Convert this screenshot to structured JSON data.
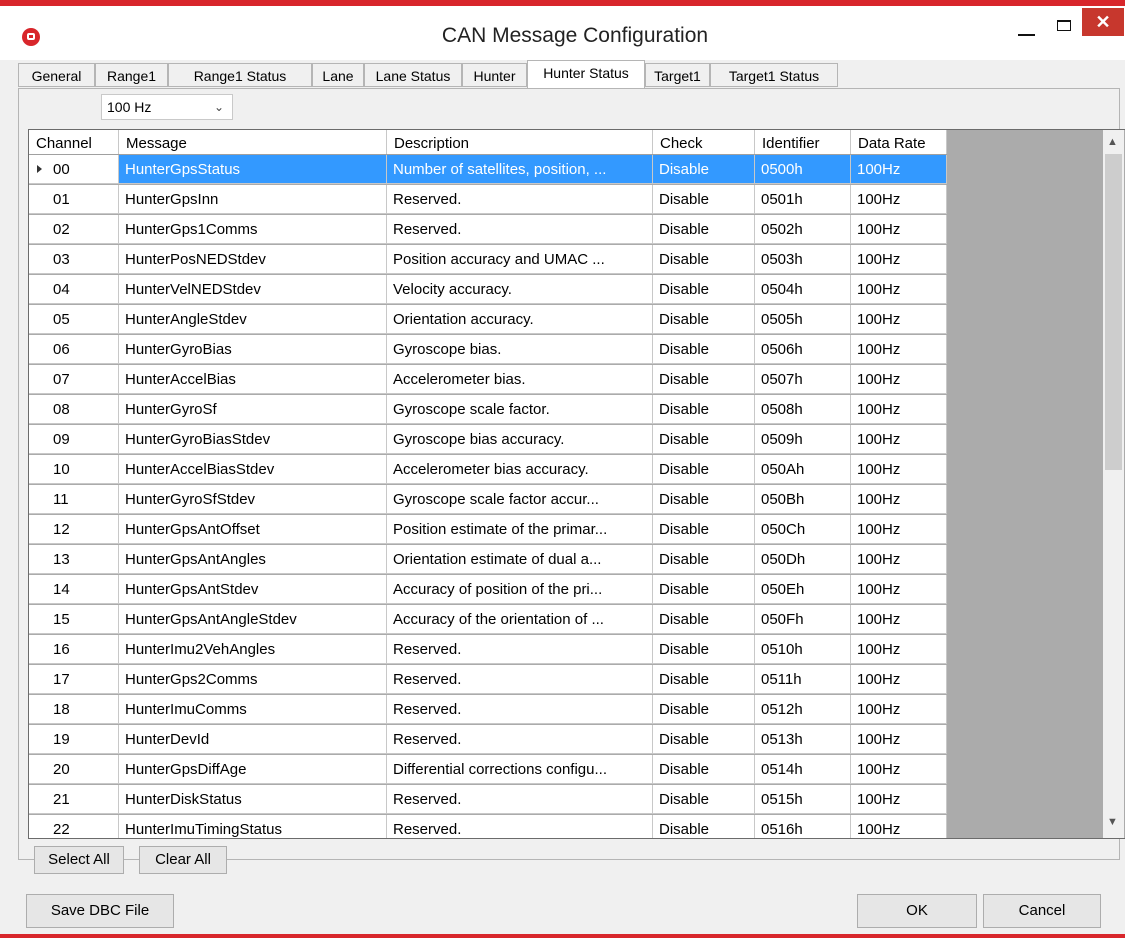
{
  "window": {
    "title": "CAN Message Configuration",
    "close_glyph": "✕",
    "accent": "#d8262b"
  },
  "tabs": [
    {
      "label": "General"
    },
    {
      "label": "Range1"
    },
    {
      "label": "Range1 Status"
    },
    {
      "label": "Lane"
    },
    {
      "label": "Lane Status"
    },
    {
      "label": "Hunter"
    },
    {
      "label": "Hunter Status",
      "active": true
    },
    {
      "label": "Target1"
    },
    {
      "label": "Target1 Status"
    }
  ],
  "rate_select": {
    "value": "100 Hz",
    "icon": "chevron-down-icon"
  },
  "grid": {
    "columns": [
      "Channel",
      "Message",
      "Description",
      "Check",
      "Identifier",
      "Data Rate"
    ],
    "selected_row": 0,
    "rows": [
      {
        "channel": "00",
        "message": "HunterGpsStatus",
        "description": "Number of satellites, position, ...",
        "check": "Disable",
        "identifier": "0500h",
        "rate": "100Hz"
      },
      {
        "channel": "01",
        "message": "HunterGpsInn",
        "description": "Reserved.",
        "check": "Disable",
        "identifier": "0501h",
        "rate": "100Hz"
      },
      {
        "channel": "02",
        "message": "HunterGps1Comms",
        "description": "Reserved.",
        "check": "Disable",
        "identifier": "0502h",
        "rate": "100Hz"
      },
      {
        "channel": "03",
        "message": "HunterPosNEDStdev",
        "description": "Position accuracy and UMAC ...",
        "check": "Disable",
        "identifier": "0503h",
        "rate": "100Hz"
      },
      {
        "channel": "04",
        "message": "HunterVelNEDStdev",
        "description": "Velocity accuracy.",
        "check": "Disable",
        "identifier": "0504h",
        "rate": "100Hz"
      },
      {
        "channel": "05",
        "message": "HunterAngleStdev",
        "description": "Orientation accuracy.",
        "check": "Disable",
        "identifier": "0505h",
        "rate": "100Hz"
      },
      {
        "channel": "06",
        "message": "HunterGyroBias",
        "description": "Gyroscope bias.",
        "check": "Disable",
        "identifier": "0506h",
        "rate": "100Hz"
      },
      {
        "channel": "07",
        "message": "HunterAccelBias",
        "description": "Accelerometer bias.",
        "check": "Disable",
        "identifier": "0507h",
        "rate": "100Hz"
      },
      {
        "channel": "08",
        "message": "HunterGyroSf",
        "description": "Gyroscope scale factor.",
        "check": "Disable",
        "identifier": "0508h",
        "rate": "100Hz"
      },
      {
        "channel": "09",
        "message": "HunterGyroBiasStdev",
        "description": "Gyroscope bias accuracy.",
        "check": "Disable",
        "identifier": "0509h",
        "rate": "100Hz"
      },
      {
        "channel": "10",
        "message": "HunterAccelBiasStdev",
        "description": "Accelerometer bias accuracy.",
        "check": "Disable",
        "identifier": "050Ah",
        "rate": "100Hz"
      },
      {
        "channel": "11",
        "message": "HunterGyroSfStdev",
        "description": "Gyroscope scale factor accur...",
        "check": "Disable",
        "identifier": "050Bh",
        "rate": "100Hz"
      },
      {
        "channel": "12",
        "message": "HunterGpsAntOffset",
        "description": "Position estimate of the primar...",
        "check": "Disable",
        "identifier": "050Ch",
        "rate": "100Hz"
      },
      {
        "channel": "13",
        "message": "HunterGpsAntAngles",
        "description": "Orientation estimate of dual a...",
        "check": "Disable",
        "identifier": "050Dh",
        "rate": "100Hz"
      },
      {
        "channel": "14",
        "message": "HunterGpsAntStdev",
        "description": "Accuracy of position of the pri...",
        "check": "Disable",
        "identifier": "050Eh",
        "rate": "100Hz"
      },
      {
        "channel": "15",
        "message": "HunterGpsAntAngleStdev",
        "description": "Accuracy of the orientation of ...",
        "check": "Disable",
        "identifier": "050Fh",
        "rate": "100Hz"
      },
      {
        "channel": "16",
        "message": "HunterImu2VehAngles",
        "description": "Reserved.",
        "check": "Disable",
        "identifier": "0510h",
        "rate": "100Hz"
      },
      {
        "channel": "17",
        "message": "HunterGps2Comms",
        "description": "Reserved.",
        "check": "Disable",
        "identifier": "0511h",
        "rate": "100Hz"
      },
      {
        "channel": "18",
        "message": "HunterImuComms",
        "description": "Reserved.",
        "check": "Disable",
        "identifier": "0512h",
        "rate": "100Hz"
      },
      {
        "channel": "19",
        "message": "HunterDevId",
        "description": "Reserved.",
        "check": "Disable",
        "identifier": "0513h",
        "rate": "100Hz"
      },
      {
        "channel": "20",
        "message": "HunterGpsDiffAge",
        "description": "Differential corrections configu...",
        "check": "Disable",
        "identifier": "0514h",
        "rate": "100Hz"
      },
      {
        "channel": "21",
        "message": "HunterDiskStatus",
        "description": "Reserved.",
        "check": "Disable",
        "identifier": "0515h",
        "rate": "100Hz"
      },
      {
        "channel": "22",
        "message": "HunterImuTimingStatus",
        "description": "Reserved.",
        "check": "Disable",
        "identifier": "0516h",
        "rate": "100Hz"
      }
    ]
  },
  "buttons": {
    "select_all": "Select All",
    "clear_all": "Clear All",
    "save_dbc": "Save DBC File",
    "ok": "OK",
    "cancel": "Cancel"
  }
}
